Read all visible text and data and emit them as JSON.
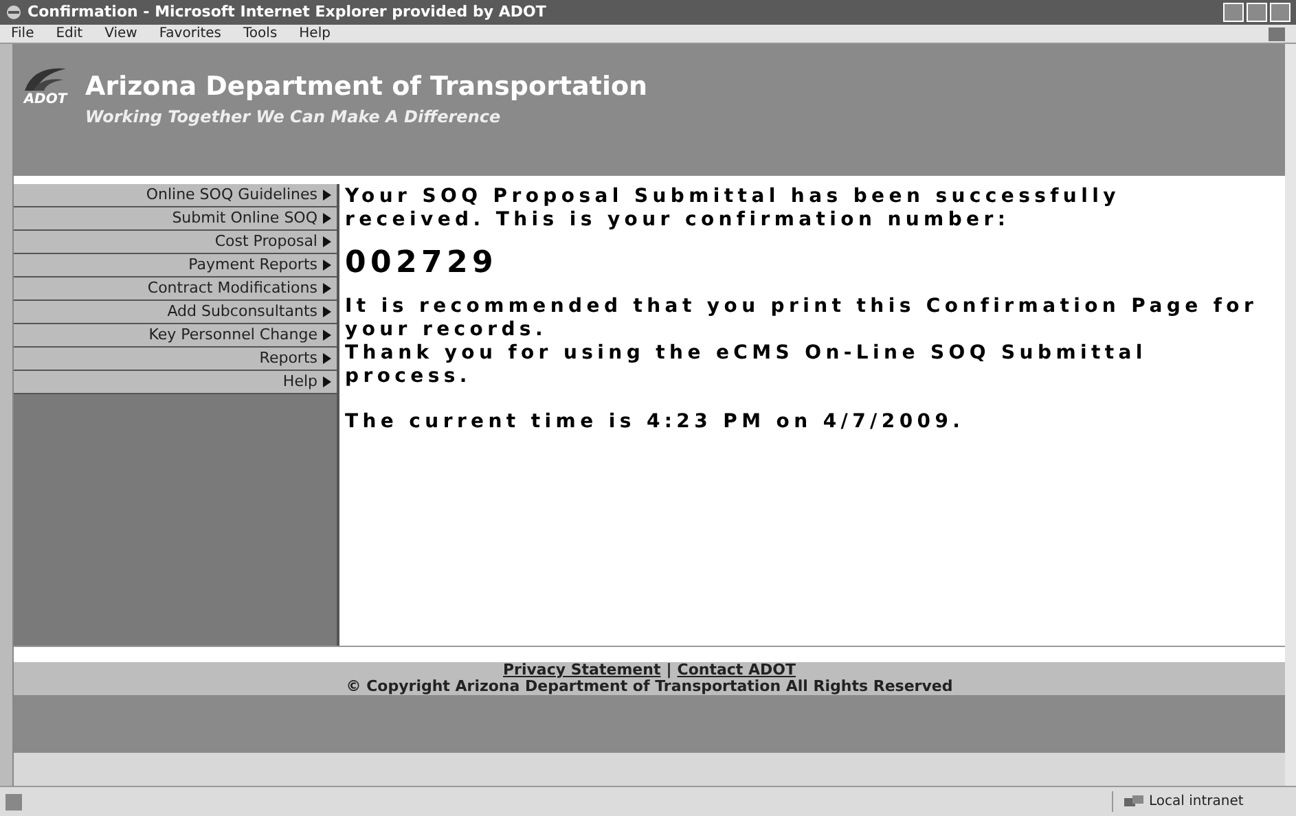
{
  "window": {
    "title": "Confirmation - Microsoft Internet Explorer provided by ADOT"
  },
  "menu": [
    "File",
    "Edit",
    "View",
    "Favorites",
    "Tools",
    "Help"
  ],
  "header": {
    "logo_text": "ADOT",
    "title": "Arizona Department of Transportation",
    "subtitle": "Working Together We Can Make A Difference"
  },
  "sidebar": {
    "items": [
      {
        "label": "Online SOQ Guidelines"
      },
      {
        "label": "Submit Online SOQ"
      },
      {
        "label": "Cost Proposal"
      },
      {
        "label": "Payment Reports"
      },
      {
        "label": "Contract Modifications"
      },
      {
        "label": "Add Subconsultants"
      },
      {
        "label": "Key Personnel Change"
      },
      {
        "label": "Reports"
      },
      {
        "label": "Help"
      }
    ]
  },
  "content": {
    "message": "Your SOQ Proposal Submittal has been successfully received. This is your confirmation number:",
    "confirmation_number": "002729",
    "recommendation": "It is recommended that you print this Confirmation Page for your records.",
    "thanks": "Thank you for using the eCMS On-Line SOQ Submittal process.",
    "time": "The current time is 4:23 PM on 4/7/2009."
  },
  "footer": {
    "links": [
      "Privacy Statement",
      "Contact ADOT"
    ],
    "separator": "|",
    "copyright": "© Copyright Arizona Department of Transportation All Rights Reserved"
  },
  "status_bar": {
    "zone": "Local intranet"
  }
}
